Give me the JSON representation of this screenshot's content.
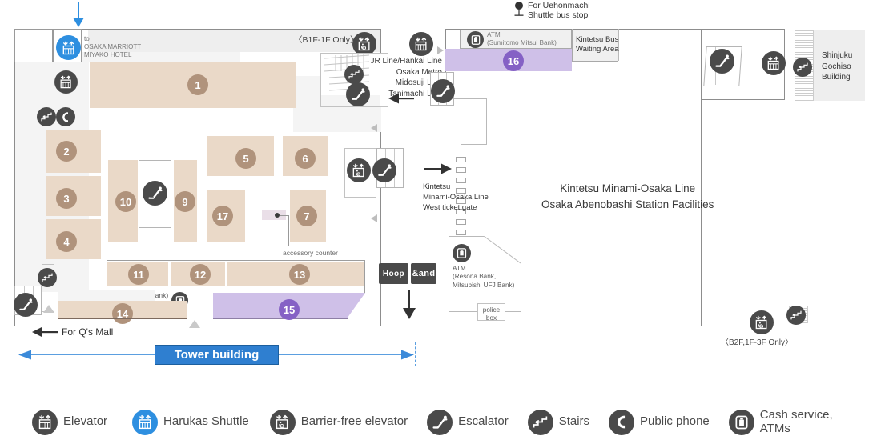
{
  "map": {
    "title_facilities": "Kintetsu Minami-Osaka Line\nOsaka Abenobashi Station Facilities",
    "bus_stop_note": "For Uehonmachi\nShuttle bus stop",
    "hotel_label": "to\nOSAKA MARRIOTT\nMIYAKO HOTEL",
    "b1f_1f_only": "〈B1F-1F Only〉",
    "b2f_1f_3f_only": "〈B2F,1F-3F Only〉",
    "rail_lines": "JR Line/Hankai Line\nOsaka Metro\nMidosuji Line\nTanimachi Line",
    "west_ticket_gate": "Kintetsu\nMinami-Osaka Line\nWest ticket gate",
    "atm_sumitomo": "ATM\n(Sumitomo Mitsui Bank)",
    "atm_resona": "ATM\n(Resona Bank,\nMitsubishi UFJ Bank)",
    "atm_seven": "ATM (Seven Bank)",
    "kintetsu_bus_waiting": "Kintetsu Bus\nWaiting Area",
    "shinjuku_gochiso": "Shinjuku\nGochiso\nBuilding",
    "police_box": "police\nbox",
    "accessory_counter": "accessory counter",
    "for_qs_mall": "For Q's Mall",
    "tower_building": "Tower building",
    "logos": [
      {
        "name": "hoop-logo",
        "text": "Hoop"
      },
      {
        "name": "and-logo",
        "text": "&and"
      }
    ],
    "shop_numbers": [
      {
        "id": "1",
        "color": "beige"
      },
      {
        "id": "2",
        "color": "beige"
      },
      {
        "id": "3",
        "color": "beige"
      },
      {
        "id": "4",
        "color": "beige"
      },
      {
        "id": "5",
        "color": "beige"
      },
      {
        "id": "6",
        "color": "beige"
      },
      {
        "id": "7",
        "color": "beige"
      },
      {
        "id": "9",
        "color": "beige"
      },
      {
        "id": "10",
        "color": "beige"
      },
      {
        "id": "11",
        "color": "beige"
      },
      {
        "id": "12",
        "color": "beige"
      },
      {
        "id": "13",
        "color": "beige"
      },
      {
        "id": "14",
        "color": "beige"
      },
      {
        "id": "15",
        "color": "purple"
      },
      {
        "id": "16",
        "color": "purple"
      },
      {
        "id": "17",
        "color": "beige"
      }
    ],
    "colors": {
      "shop_beige": "#ead9c8",
      "shop_purple": "#cfc0e8",
      "badge_beige": "#b0937c",
      "badge_purple": "#8561c5",
      "icon_dark": "#4a4a4a",
      "icon_blue": "#2e8fe0",
      "tower_blue": "#2f7fd0",
      "wall": "#8d8d8d"
    }
  },
  "legend": {
    "items": [
      {
        "icon": "elevator-icon",
        "label": "Elevator",
        "style": "dark"
      },
      {
        "icon": "harukas-shuttle-icon",
        "label": "Harukas Shuttle",
        "style": "blue"
      },
      {
        "icon": "barrier-free-elevator-icon",
        "label": "Barrier-free elevator",
        "style": "dark"
      },
      {
        "icon": "escalator-icon",
        "label": "Escalator",
        "style": "dark"
      },
      {
        "icon": "stairs-icon",
        "label": "Stairs",
        "style": "dark"
      },
      {
        "icon": "public-phone-icon",
        "label": "Public phone",
        "style": "dark"
      },
      {
        "icon": "atm-icon",
        "label": "Cash service,\nATMs",
        "style": "dark"
      }
    ]
  }
}
